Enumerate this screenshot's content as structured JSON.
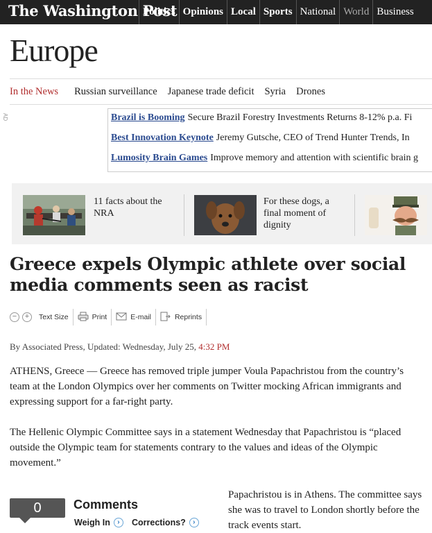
{
  "masthead": {
    "logo": "The Washington Post"
  },
  "nav": [
    "Politics",
    "Opinions",
    "Local",
    "Sports",
    "National",
    "World",
    "Business"
  ],
  "section_title": "Europe",
  "trending": {
    "lead": "In the News",
    "tags": [
      "Russian surveillance",
      "Japanese trade deficit",
      "Syria",
      "Drones"
    ]
  },
  "ads": {
    "label": "AD",
    "rows": [
      {
        "link": "Brazil is Booming",
        "desc": "Secure Brazil Forestry Investments Returns 8-12% p.a. Fi"
      },
      {
        "link": "Best Innovation Keynote",
        "desc": "Jeremy Gutsche, CEO of Trend Hunter Trends, In"
      },
      {
        "link": "Lumosity Brain Games",
        "desc": "Improve memory and attention with scientific brain g"
      }
    ]
  },
  "promos": [
    {
      "text": "11 facts about the NRA"
    },
    {
      "text": "For these dogs, a final moment of dignity"
    },
    {
      "text": ""
    }
  ],
  "article": {
    "headline": "Greece expels Olympic athlete over social media comments seen as racist",
    "toolbar": {
      "text_size": "Text Size",
      "print": "Print",
      "email": "E-mail",
      "reprints": "Reprints"
    },
    "byline_prefix": "By Associated Press, Updated: Wednesday, July 25,",
    "byline_time": "4:32 PM",
    "paragraphs": [
      "ATHENS, Greece — Greece has removed triple jumper Voula Papachristou from the country’s team at the London Olympics over her comments on Twitter mocking African immigrants and expressing support for a far-right party.",
      "The Hellenic Olympic Committee says in a statement Wednesday that Papachristou is “placed outside the Olympic team for statements contrary to the values and ideas of the Olympic movement.”",
      "Papachristou is in Athens. The committee says she was to travel to London shortly before the track events start."
    ]
  },
  "comments": {
    "count": "0",
    "title": "Comments",
    "weigh_in": "Weigh In",
    "corrections": "Corrections?"
  }
}
